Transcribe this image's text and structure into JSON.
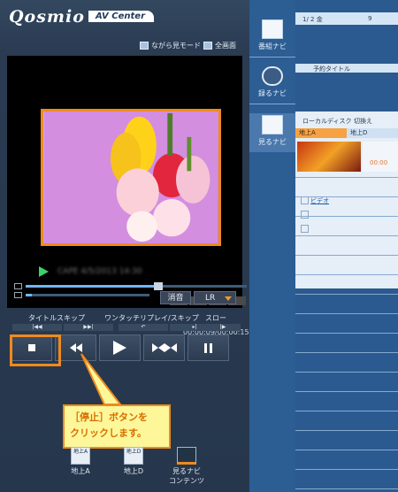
{
  "app": {
    "logo": "Qosmio",
    "subtitle": "AV Center"
  },
  "modes": {
    "nagara": "ながら見モード",
    "full": "全画面"
  },
  "player": {
    "time": "00:00:09/00:00:15",
    "blurred_info": "CAPE  4/5/2013  14:30",
    "mute_label": "消音",
    "audio_label": "LR",
    "seek_progress": 0.6,
    "volume_level": 0.05
  },
  "controls": {
    "title_skip": "タイトルスキップ",
    "onetouch": "ワンタッチリプレイ/スキップ",
    "slow": "スロー"
  },
  "callout": {
    "line1": "［停止］ボタンを",
    "line2": "クリックします。"
  },
  "bottom_nav": [
    {
      "box": "地上A",
      "label": "地上A"
    },
    {
      "box": "地上D",
      "label": "地上D"
    },
    {
      "box": "",
      "label": "見るナビ コンテンツ"
    }
  ],
  "right": {
    "nav": [
      {
        "label": "番組ナビ",
        "icon": "program-guide-icon"
      },
      {
        "label": "録るナビ",
        "icon": "record-icon"
      },
      {
        "label": "見るナビ",
        "icon": "watch-icon"
      }
    ],
    "row1_left": "1/ 2  金",
    "row1_right": "9",
    "reserve_title": "予約タイトル",
    "source_label": "ローカルディスク",
    "switch_label": "切換え",
    "tab_a": "地上A",
    "tab_d": "地上D",
    "video_label": "ビデオ",
    "thumb_time": "00:00"
  },
  "colors": {
    "highlight": "#f08a1c",
    "callout_bg": "#fdf79a"
  }
}
